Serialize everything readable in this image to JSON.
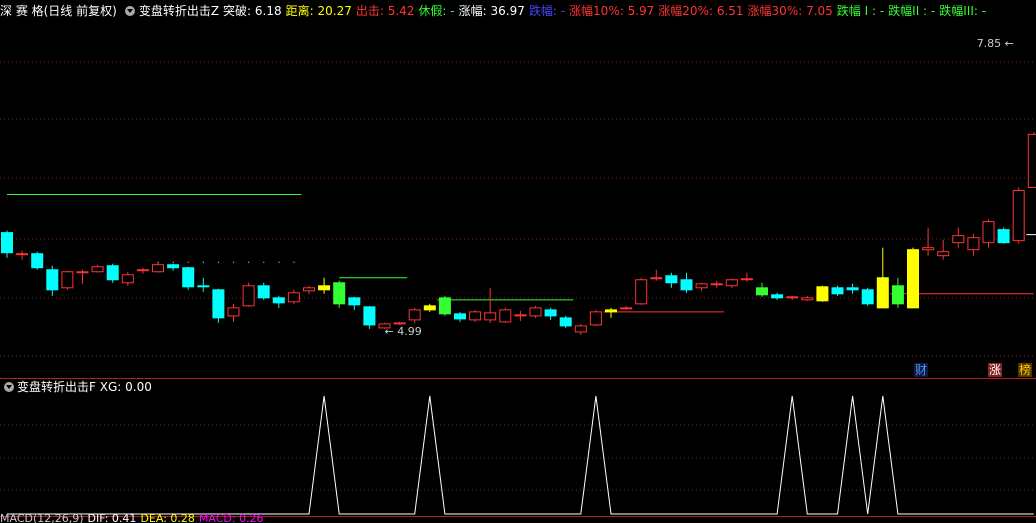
{
  "header": {
    "stock": "深 赛 格(日线 前复权)",
    "indicator": "变盘转折出击Z",
    "items": [
      {
        "label": "突破:",
        "value": "6.18",
        "color": "#ffffff"
      },
      {
        "label": "距离:",
        "value": "20.27",
        "color": "#ffff00"
      },
      {
        "label": "出击:",
        "value": "5.42",
        "color": "#ff3333"
      },
      {
        "label": "休假:",
        "value": "-",
        "color": "#33ff33"
      },
      {
        "label": "涨幅:",
        "value": "36.97",
        "color": "#ffffff"
      },
      {
        "label": "跌幅:",
        "value": "-",
        "color": "#4444ff"
      },
      {
        "label": "涨幅10%:",
        "value": "5.97",
        "color": "#ff3333"
      },
      {
        "label": "涨幅20%:",
        "value": "6.51",
        "color": "#ff3333"
      },
      {
        "label": "涨幅30%:",
        "value": "7.05",
        "color": "#ff3333"
      },
      {
        "label": "跌幅 I :",
        "value": "-",
        "color": "#33ff33"
      },
      {
        "label": "跌幅II :",
        "value": "-",
        "color": "#33ff33"
      },
      {
        "label": "跌幅III:",
        "value": "-",
        "color": "#33ff33"
      }
    ]
  },
  "subheader": {
    "indicator": "变盘转折出击F",
    "label": "XG:",
    "value": "0.00"
  },
  "footer": {
    "items": [
      {
        "text": "MACD(12,26,9)",
        "color": "#cccccc"
      },
      {
        "text": "DIF: 0.41",
        "color": "#ffffff"
      },
      {
        "text": "DEA: 0.28",
        "color": "#ffff00"
      },
      {
        "text": "MACD: 0.26",
        "color": "#ff00ff"
      }
    ]
  },
  "badges": [
    {
      "text": "财",
      "color": "#4499ff",
      "bg": "#101840",
      "x": 914
    },
    {
      "text": "涨",
      "color": "#ffffff",
      "bg": "#882222",
      "x": 988
    },
    {
      "text": "榜",
      "color": "#ffcc00",
      "bg": "#553300",
      "x": 1018
    }
  ],
  "chart_data": [
    {
      "type": "candlestick",
      "title": "深 赛 格(日线 前复权)",
      "ylim": [
        4.7,
        8.05
      ],
      "annotations": [
        {
          "text": "7.85",
          "index": 67,
          "value": 7.85
        },
        {
          "text": "4.99",
          "index": 25,
          "value": 4.99
        }
      ],
      "colors": {
        "up": "#ff3333",
        "down": "#00ffff",
        "signal": "#ffff00",
        "break": "#33ff33"
      },
      "candles": [
        {
          "o": 5.95,
          "h": 5.97,
          "l": 5.7,
          "c": 5.75
        },
        {
          "o": 5.73,
          "h": 5.77,
          "l": 5.68,
          "c": 5.74
        },
        {
          "o": 5.74,
          "h": 5.76,
          "l": 5.58,
          "c": 5.6
        },
        {
          "o": 5.58,
          "h": 5.62,
          "l": 5.32,
          "c": 5.38
        },
        {
          "o": 5.4,
          "h": 5.57,
          "l": 5.38,
          "c": 5.56
        },
        {
          "o": 5.55,
          "h": 5.58,
          "l": 5.44,
          "c": 5.56
        },
        {
          "o": 5.56,
          "h": 5.63,
          "l": 5.55,
          "c": 5.61
        },
        {
          "o": 5.62,
          "h": 5.64,
          "l": 5.45,
          "c": 5.48
        },
        {
          "o": 5.45,
          "h": 5.56,
          "l": 5.42,
          "c": 5.53
        },
        {
          "o": 5.58,
          "h": 5.6,
          "l": 5.54,
          "c": 5.58
        },
        {
          "o": 5.56,
          "h": 5.65,
          "l": 5.55,
          "c": 5.63
        },
        {
          "o": 5.63,
          "h": 5.64,
          "l": 5.57,
          "c": 5.6
        },
        {
          "o": 5.6,
          "h": 5.61,
          "l": 5.38,
          "c": 5.41
        },
        {
          "o": 5.42,
          "h": 5.5,
          "l": 5.36,
          "c": 5.41
        },
        {
          "o": 5.38,
          "h": 5.39,
          "l": 5.05,
          "c": 5.1
        },
        {
          "o": 5.12,
          "h": 5.24,
          "l": 5.06,
          "c": 5.2
        },
        {
          "o": 5.22,
          "h": 5.45,
          "l": 5.21,
          "c": 5.42
        },
        {
          "o": 5.42,
          "h": 5.45,
          "l": 5.28,
          "c": 5.3
        },
        {
          "o": 5.3,
          "h": 5.32,
          "l": 5.2,
          "c": 5.25
        },
        {
          "o": 5.26,
          "h": 5.38,
          "l": 5.24,
          "c": 5.35
        },
        {
          "o": 5.37,
          "h": 5.42,
          "l": 5.34,
          "c": 5.4
        },
        {
          "o": 5.42,
          "h": 5.5,
          "l": 5.34,
          "c": 5.38,
          "hl": "signal"
        },
        {
          "o": 5.45,
          "h": 5.47,
          "l": 5.2,
          "c": 5.24,
          "hl": "break"
        },
        {
          "o": 5.3,
          "h": 5.31,
          "l": 5.18,
          "c": 5.23
        },
        {
          "o": 5.21,
          "h": 5.22,
          "l": 4.99,
          "c": 5.03
        },
        {
          "o": 5.0,
          "h": 5.05,
          "l": 4.99,
          "c": 5.04
        },
        {
          "o": 5.04,
          "h": 5.06,
          "l": 5.03,
          "c": 5.05
        },
        {
          "o": 5.08,
          "h": 5.2,
          "l": 5.05,
          "c": 5.18
        },
        {
          "o": 5.18,
          "h": 5.24,
          "l": 5.16,
          "c": 5.22,
          "hl": "signal"
        },
        {
          "o": 5.3,
          "h": 5.32,
          "l": 5.12,
          "c": 5.14,
          "hl": "break"
        },
        {
          "o": 5.14,
          "h": 5.16,
          "l": 5.06,
          "c": 5.09
        },
        {
          "o": 5.08,
          "h": 5.18,
          "l": 5.06,
          "c": 5.16
        },
        {
          "o": 5.08,
          "h": 5.4,
          "l": 5.05,
          "c": 5.15
        },
        {
          "o": 5.06,
          "h": 5.2,
          "l": 5.05,
          "c": 5.18
        },
        {
          "o": 5.12,
          "h": 5.17,
          "l": 5.07,
          "c": 5.13
        },
        {
          "o": 5.12,
          "h": 5.22,
          "l": 5.1,
          "c": 5.2
        },
        {
          "o": 5.18,
          "h": 5.2,
          "l": 5.08,
          "c": 5.12
        },
        {
          "o": 5.1,
          "h": 5.12,
          "l": 5.0,
          "c": 5.02
        },
        {
          "o": 4.96,
          "h": 5.04,
          "l": 4.93,
          "c": 5.02
        },
        {
          "o": 5.03,
          "h": 5.18,
          "l": 5.02,
          "c": 5.16
        },
        {
          "o": 5.16,
          "h": 5.2,
          "l": 5.1,
          "c": 5.18,
          "hl": "signal"
        },
        {
          "o": 5.2,
          "h": 5.22,
          "l": 5.18,
          "c": 5.2
        },
        {
          "o": 5.24,
          "h": 5.5,
          "l": 5.23,
          "c": 5.48
        },
        {
          "o": 5.5,
          "h": 5.58,
          "l": 5.47,
          "c": 5.5
        },
        {
          "o": 5.52,
          "h": 5.55,
          "l": 5.4,
          "c": 5.45
        },
        {
          "o": 5.48,
          "h": 5.55,
          "l": 5.35,
          "c": 5.38
        },
        {
          "o": 5.4,
          "h": 5.45,
          "l": 5.37,
          "c": 5.44
        },
        {
          "o": 5.44,
          "h": 5.47,
          "l": 5.4,
          "c": 5.44
        },
        {
          "o": 5.42,
          "h": 5.49,
          "l": 5.4,
          "c": 5.48
        },
        {
          "o": 5.48,
          "h": 5.55,
          "l": 5.46,
          "c": 5.49
        },
        {
          "o": 5.4,
          "h": 5.45,
          "l": 5.31,
          "c": 5.33,
          "hl": "break"
        },
        {
          "o": 5.33,
          "h": 5.35,
          "l": 5.28,
          "c": 5.3
        },
        {
          "o": 5.3,
          "h": 5.32,
          "l": 5.28,
          "c": 5.31
        },
        {
          "o": 5.28,
          "h": 5.32,
          "l": 5.27,
          "c": 5.3
        },
        {
          "o": 5.27,
          "h": 5.42,
          "l": 5.26,
          "c": 5.41,
          "hl": "signal"
        },
        {
          "o": 5.4,
          "h": 5.42,
          "l": 5.32,
          "c": 5.34
        },
        {
          "o": 5.4,
          "h": 5.44,
          "l": 5.34,
          "c": 5.38
        },
        {
          "o": 5.38,
          "h": 5.4,
          "l": 5.22,
          "c": 5.24
        },
        {
          "o": 5.2,
          "h": 5.8,
          "l": 5.2,
          "c": 5.5,
          "hl": "signal"
        },
        {
          "o": 5.42,
          "h": 5.5,
          "l": 5.2,
          "c": 5.24,
          "hl": "break"
        },
        {
          "o": 5.2,
          "h": 5.8,
          "l": 5.2,
          "c": 5.78,
          "hl": "signal"
        },
        {
          "o": 5.78,
          "h": 6.0,
          "l": 5.72,
          "c": 5.8
        },
        {
          "o": 5.72,
          "h": 5.88,
          "l": 5.68,
          "c": 5.76
        },
        {
          "o": 5.85,
          "h": 6.0,
          "l": 5.8,
          "c": 5.92
        },
        {
          "o": 5.78,
          "h": 5.94,
          "l": 5.72,
          "c": 5.9
        },
        {
          "o": 5.85,
          "h": 6.08,
          "l": 5.8,
          "c": 6.06
        },
        {
          "o": 5.98,
          "h": 6.0,
          "l": 5.84,
          "c": 5.85
        },
        {
          "o": 5.87,
          "h": 6.4,
          "l": 5.84,
          "c": 6.37
        },
        {
          "o": 6.4,
          "h": 6.95,
          "l": 6.4,
          "c": 6.93
        },
        {
          "o": 7.15,
          "h": 7.85,
          "l": 6.75,
          "c": 7.6
        },
        {
          "o": 6.95,
          "h": 7.3,
          "l": 6.5,
          "c": 7.28
        }
      ],
      "lines": [
        {
          "name": "",
          "color": "#33ff33",
          "from": 0,
          "to": 19.5,
          "value": 6.33
        },
        {
          "name": "",
          "color": "#33ff33",
          "from": 22,
          "to": 26.5,
          "value": 5.5
        },
        {
          "name": "",
          "color": "#33ff33",
          "from": 28.5,
          "to": 37.5,
          "value": 5.28
        },
        {
          "name": "",
          "color": "#ff3333",
          "from": 39.5,
          "to": 47.5,
          "value": 5.16
        },
        {
          "name": "",
          "color": "#ff3333",
          "from": 58.5,
          "to": 68,
          "value": 5.34
        },
        {
          "name": "",
          "color": "#ffffff",
          "from": 67.5,
          "to": 68.5,
          "value": 5.93
        }
      ],
      "dots": [
        {
          "color": "#aaaaaa",
          "from": 10,
          "to": 19,
          "value": 5.66
        }
      ]
    },
    {
      "type": "line",
      "title": "变盘转折出击F",
      "ylim": [
        0,
        1
      ],
      "series": [
        {
          "name": "XG",
          "color": "#ffffff",
          "values": [
            0,
            0,
            0,
            0,
            0,
            0,
            0,
            0,
            0,
            0,
            0,
            0,
            0,
            0,
            0,
            0,
            0,
            0,
            0,
            0,
            0,
            1,
            0,
            0,
            0,
            0,
            0,
            0,
            1,
            0,
            0,
            0,
            0,
            0,
            0,
            0,
            0,
            0,
            0,
            1,
            0,
            0,
            0,
            0,
            0,
            0,
            0,
            0,
            0,
            0,
            0,
            0,
            1,
            0,
            0,
            0,
            1,
            0,
            1,
            0,
            0,
            0,
            0,
            0,
            0,
            0,
            0,
            0,
            0
          ]
        }
      ]
    }
  ]
}
